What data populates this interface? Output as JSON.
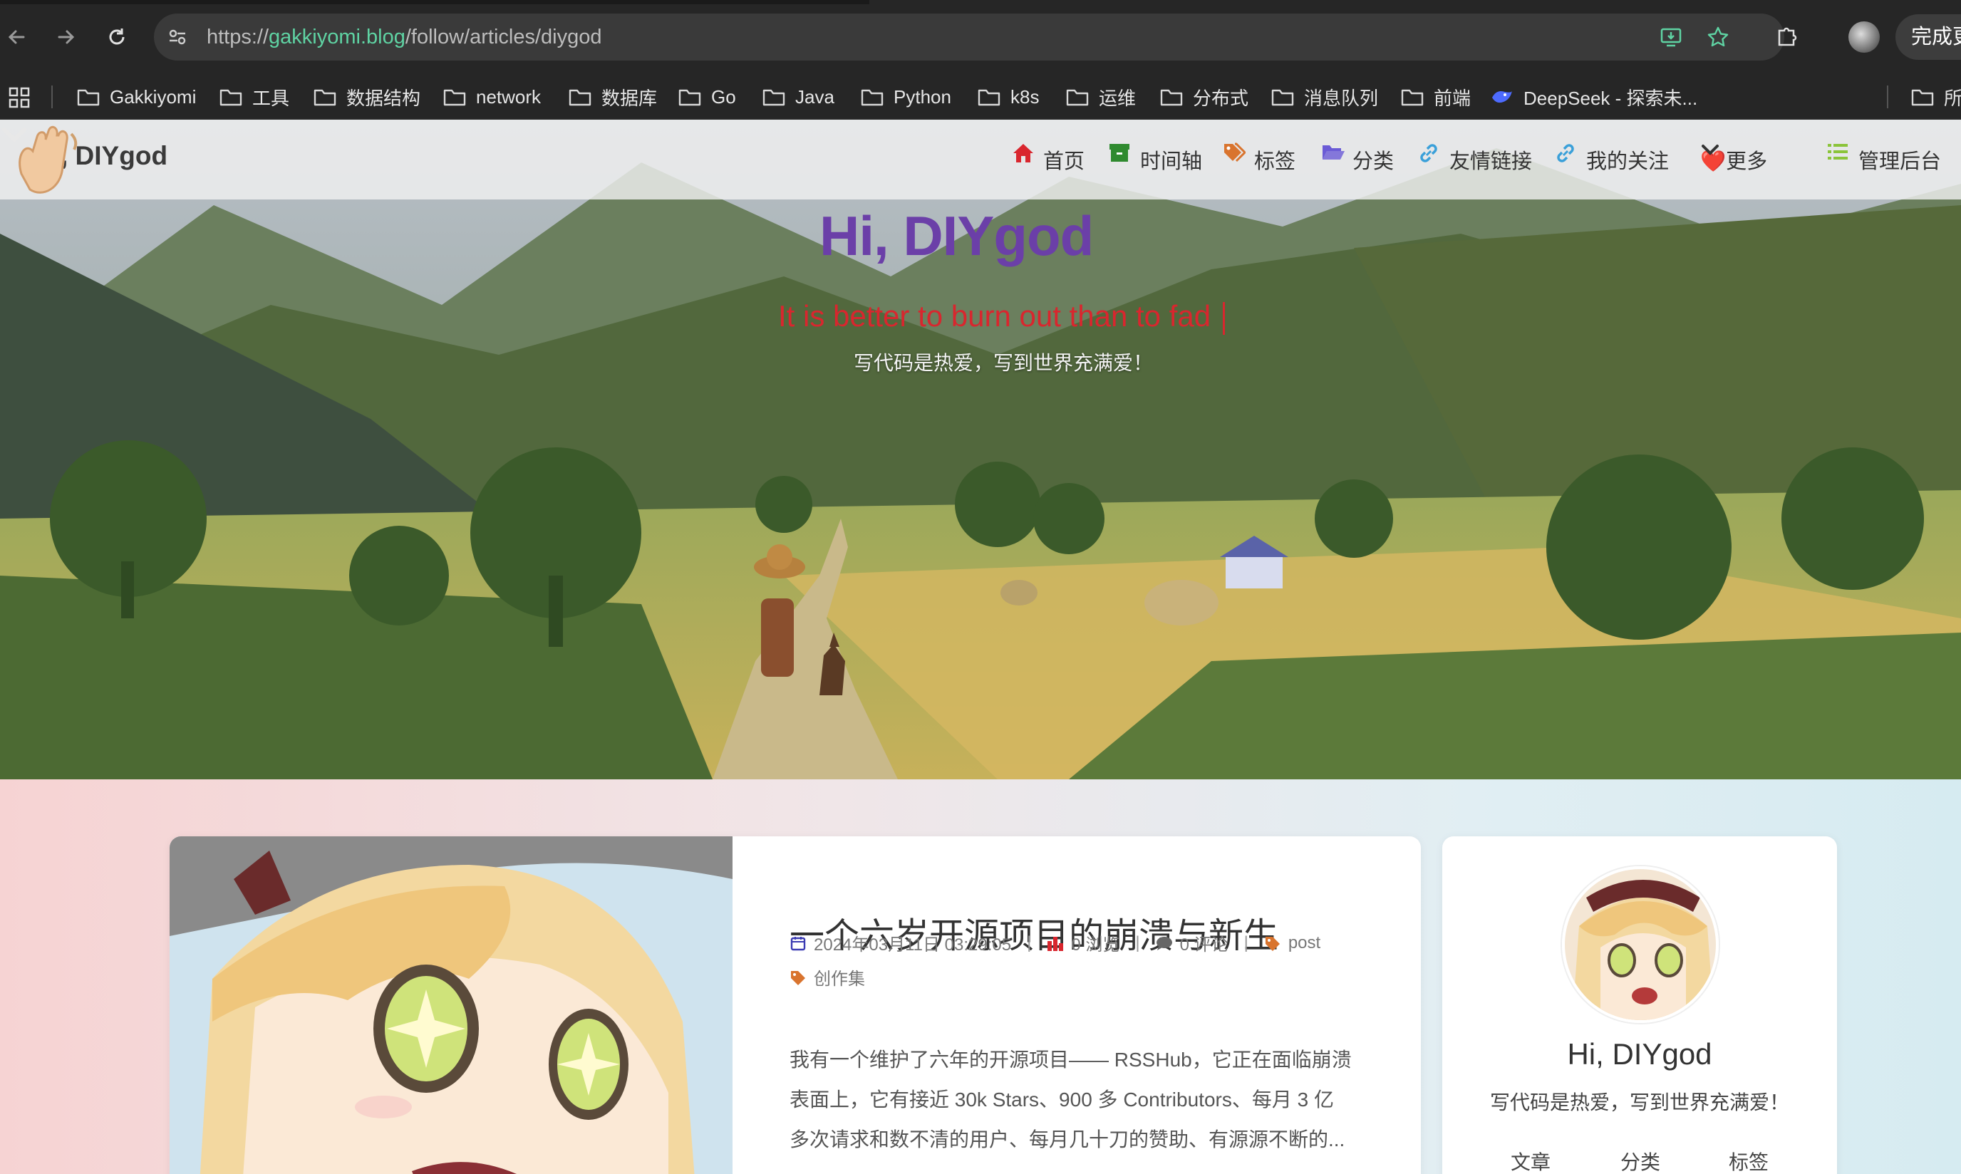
{
  "browser": {
    "url_scheme": "https://",
    "url_domain": "gakkiyomi.blog",
    "url_path": "/follow/articles/diygod",
    "finish_button": "完成更",
    "bookmarks": [
      {
        "label": "Gakkiyomi"
      },
      {
        "label": "工具"
      },
      {
        "label": "数据结构"
      },
      {
        "label": "network"
      },
      {
        "label": "数据库"
      },
      {
        "label": "Go"
      },
      {
        "label": "Java"
      },
      {
        "label": "Python"
      },
      {
        "label": "k8s"
      },
      {
        "label": "运维"
      },
      {
        "label": "分布式"
      },
      {
        "label": "消息队列"
      },
      {
        "label": "前端"
      },
      {
        "label": "DeepSeek - 探索未..."
      },
      {
        "label": "所"
      }
    ]
  },
  "site": {
    "logo": "Hi, DIYgod",
    "nav": [
      {
        "label": "首页",
        "icon": "home-icon"
      },
      {
        "label": "时间轴",
        "icon": "archive-icon"
      },
      {
        "label": "标签",
        "icon": "tags-icon"
      },
      {
        "label": "分类",
        "icon": "folder-open-icon"
      },
      {
        "label": "友情链接",
        "icon": "link-icon"
      },
      {
        "label": "我的关注",
        "icon": "link-icon"
      },
      {
        "label": "❤️更多",
        "icon": "chevron-down-icon"
      },
      {
        "label": "管理后台",
        "icon": "list-icon"
      }
    ],
    "colors": {
      "title": "#6b3fa8",
      "motto": "#d9262e",
      "nav_home": "#d9262e",
      "nav_archive": "#2f8a2f",
      "nav_tags": "#d9742e",
      "nav_folder": "#6b5bd6",
      "nav_link": "#3aa0d9",
      "nav_list": "#8bc43a"
    }
  },
  "hero": {
    "title": "Hi, DIYgod",
    "motto": "It is better to burn out than to fad",
    "subtitle": "写代码是热爱，写到世界充满爱！"
  },
  "article": {
    "title": "一个六岁开源项目的崩溃与新生",
    "date": "2024年03月11日 03:29:05",
    "views": "0 浏览",
    "comments": "0 评论",
    "category": "post",
    "tag": "创作集",
    "excerpt_lines": [
      "我有一个维护了六年的开源项目—— RSSHub，它正在面临崩溃",
      "表面上，它有接近 30k Stars、900 多 Contributors、每月 3 亿",
      "多次请求和数不清的用户、每月几十刀的赞助、有源源不断的..."
    ]
  },
  "profile": {
    "name": "Hi, DIYgod",
    "bio": "写代码是热爱，写到世界充满爱！",
    "stats": [
      {
        "label": "文章"
      },
      {
        "label": "分类"
      },
      {
        "label": "标签"
      }
    ]
  }
}
